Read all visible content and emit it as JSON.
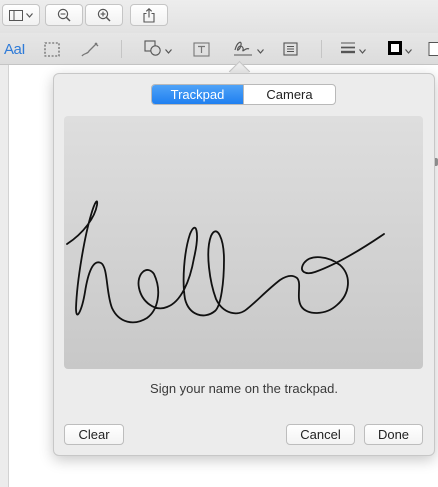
{
  "toolbar": {
    "sidebar_icon": "sidebar-icon",
    "zoom_out_icon": "zoom-out-icon",
    "zoom_in_icon": "zoom-in-icon",
    "share_icon": "share-icon"
  },
  "markup_toolbar": {
    "text_style_label": "AaI",
    "tools": [
      "rectangular-selection-icon",
      "sketch-icon",
      "shapes-icon",
      "text-box-icon",
      "signature-icon",
      "note-icon",
      "line-style-icon",
      "border-color-icon",
      "fill-color-icon"
    ],
    "accent_color": "#2f7bd8"
  },
  "signature_popover": {
    "tabs": [
      {
        "label": "Trackpad",
        "selected": true
      },
      {
        "label": "Camera",
        "selected": false
      }
    ],
    "instruction": "Sign your name on the trackpad.",
    "clear_label": "Clear",
    "cancel_label": "Cancel",
    "done_label": "Done",
    "selected_tab_color": "#1f7ff0"
  }
}
